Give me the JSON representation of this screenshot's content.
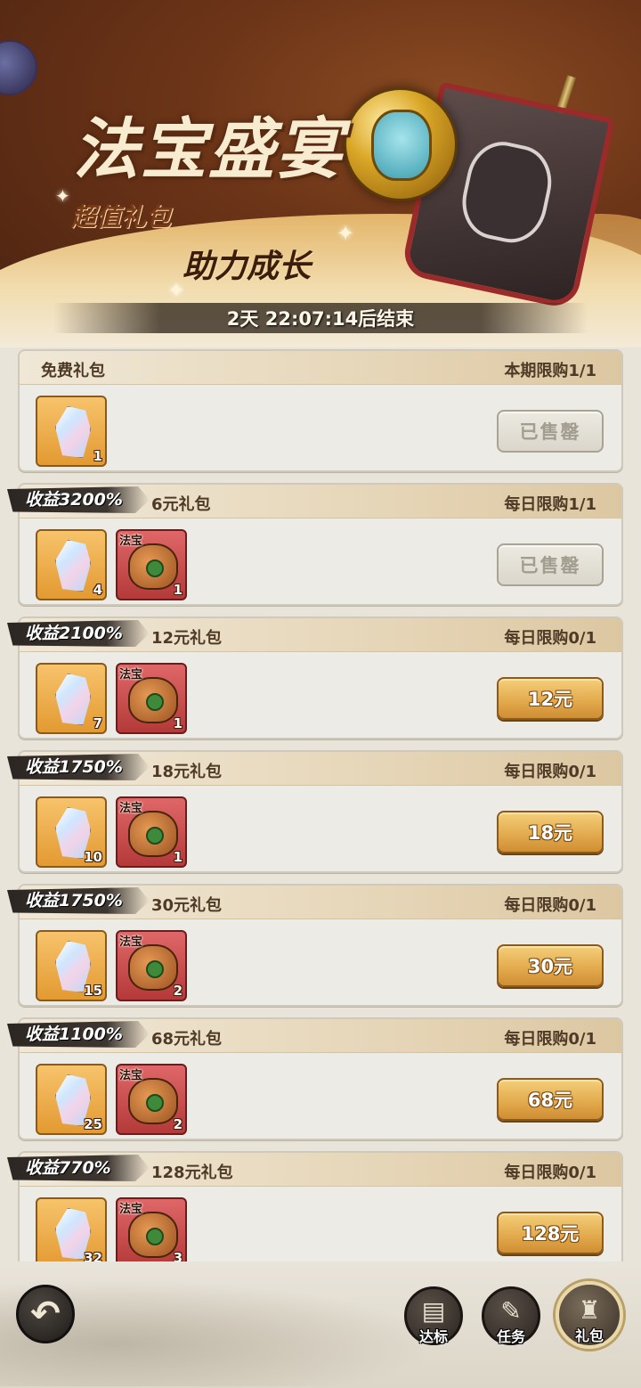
{
  "banner": {
    "title": "法宝盛宴",
    "subtitle1": "超值礼包",
    "subtitle2": "助力成长",
    "timer": "2天 22:07:14后结束"
  },
  "packages": [
    {
      "badge": "",
      "name": "免费礼包",
      "limit": "本期限购1/1",
      "gem_count": "1",
      "bag_count": "",
      "bag_label": "",
      "button": "已售罄",
      "sold_out": true
    },
    {
      "badge": "收益3200%",
      "name": "6元礼包",
      "limit": "每日限购1/1",
      "gem_count": "4",
      "bag_count": "1",
      "bag_label": "法宝",
      "button": "已售罄",
      "sold_out": true
    },
    {
      "badge": "收益2100%",
      "name": "12元礼包",
      "limit": "每日限购0/1",
      "gem_count": "7",
      "bag_count": "1",
      "bag_label": "法宝",
      "button": "12元",
      "sold_out": false
    },
    {
      "badge": "收益1750%",
      "name": "18元礼包",
      "limit": "每日限购0/1",
      "gem_count": "10",
      "bag_count": "1",
      "bag_label": "法宝",
      "button": "18元",
      "sold_out": false
    },
    {
      "badge": "收益1750%",
      "name": "30元礼包",
      "limit": "每日限购0/1",
      "gem_count": "15",
      "bag_count": "2",
      "bag_label": "法宝",
      "button": "30元",
      "sold_out": false
    },
    {
      "badge": "收益1100%",
      "name": "68元礼包",
      "limit": "每日限购0/1",
      "gem_count": "25",
      "bag_count": "2",
      "bag_label": "法宝",
      "button": "68元",
      "sold_out": false
    },
    {
      "badge": "收益770%",
      "name": "128元礼包",
      "limit": "每日限购0/1",
      "gem_count": "32",
      "bag_count": "3",
      "bag_label": "法宝",
      "button": "128元",
      "sold_out": false
    }
  ],
  "nav": {
    "back_icon": "back-arrow-icon",
    "items": [
      {
        "label": "达标",
        "icon": "scroll-icon",
        "active": false
      },
      {
        "label": "任务",
        "icon": "task-scroll-icon",
        "active": false
      },
      {
        "label": "礼包",
        "icon": "gift-bag-icon",
        "active": true
      }
    ]
  },
  "colors": {
    "accent": "#e2a84b",
    "card_bg": "#ecebe5",
    "ribbon": "#2c2622"
  }
}
